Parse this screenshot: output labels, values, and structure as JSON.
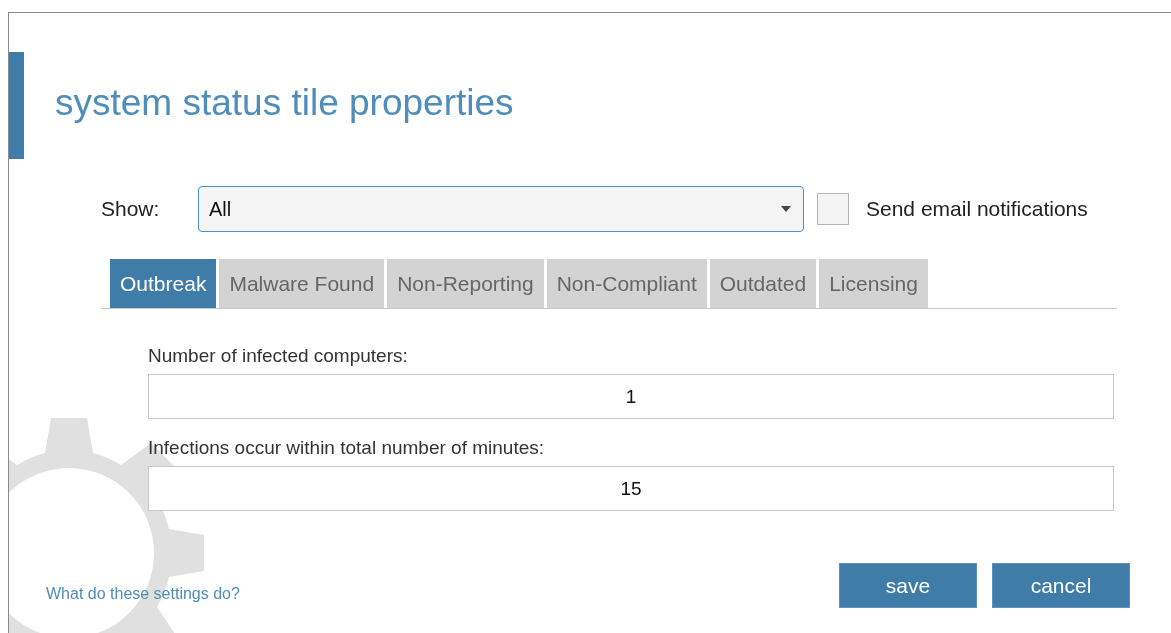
{
  "dialog": {
    "title": "system status tile properties"
  },
  "show": {
    "label": "Show:",
    "value": "All"
  },
  "email_notifications": {
    "label": "Send email notifications",
    "checked": false
  },
  "tabs": [
    {
      "label": "Outbreak",
      "selected": true
    },
    {
      "label": "Malware Found",
      "selected": false
    },
    {
      "label": "Non-Reporting",
      "selected": false
    },
    {
      "label": "Non-Compliant",
      "selected": false
    },
    {
      "label": "Outdated",
      "selected": false
    },
    {
      "label": "Licensing",
      "selected": false
    }
  ],
  "fields": [
    {
      "label": "Number of infected computers:",
      "value": "1"
    },
    {
      "label": "Infections occur within total number of minutes:",
      "value": "15"
    }
  ],
  "help_link": "What do these settings do?",
  "buttons": [
    "save",
    "cancel"
  ]
}
